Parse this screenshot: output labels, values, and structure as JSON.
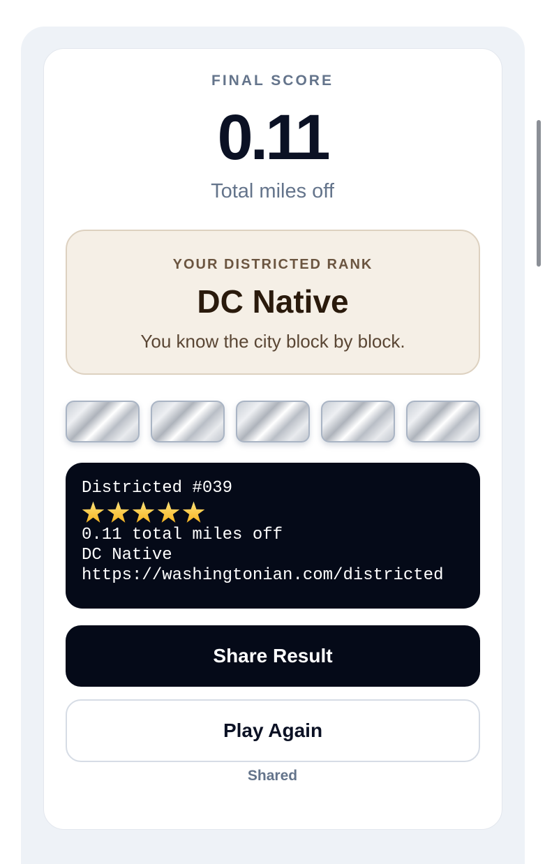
{
  "score": {
    "label": "FINAL SCORE",
    "value": "0.11",
    "unit_label": "Total miles off"
  },
  "rank": {
    "label": "YOUR DISTRICTED RANK",
    "name": "DC Native",
    "description": "You know the city block by block."
  },
  "tiles": {
    "count": 5,
    "style": "silver"
  },
  "share_text": {
    "title": "Districted #039",
    "stars": 5,
    "star_icon": "star-icon",
    "line_score": "0.11 total miles off",
    "line_rank": "DC Native",
    "line_url": "https://washingtonian.com/districted"
  },
  "actions": {
    "share_label": "Share Result",
    "play_again_label": "Play Again",
    "status": "Shared"
  },
  "colors": {
    "primary_dark": "#050a18",
    "muted": "#64748b",
    "rank_bg": "#f5efe6",
    "rank_text": "#2a1a0c"
  }
}
